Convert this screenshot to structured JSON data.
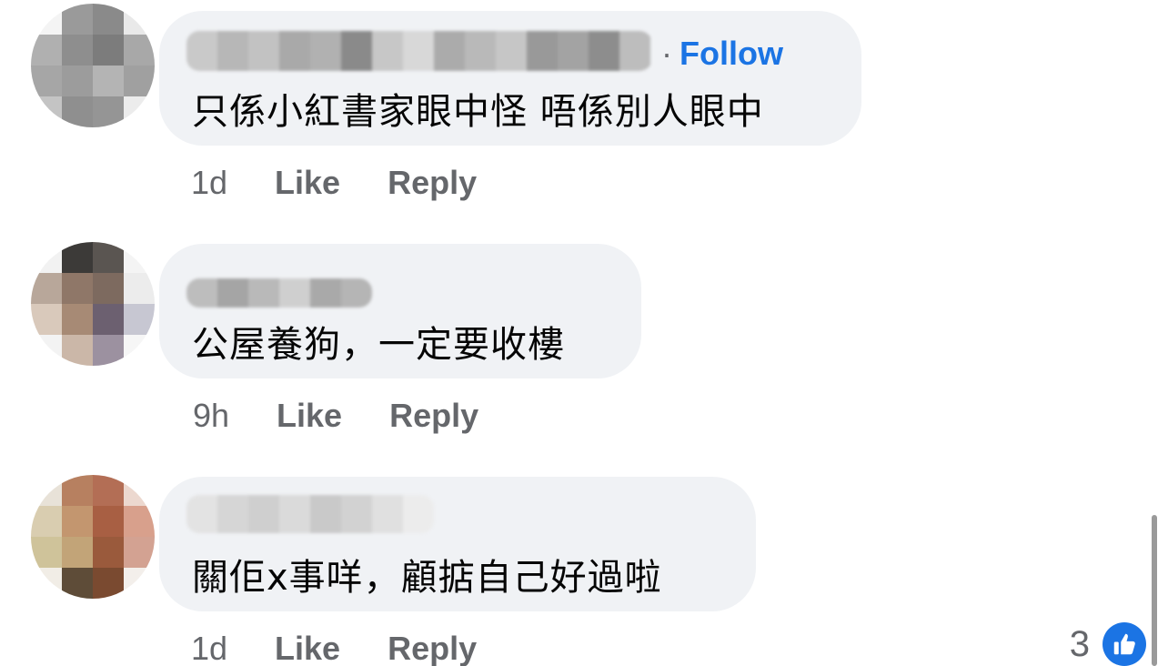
{
  "comments": [
    {
      "text": "只係小紅書家眼中怪 唔係別人眼中",
      "follow_label": "Follow",
      "follow_separator": "·",
      "time": "1d",
      "like_label": "Like",
      "reply_label": "Reply"
    },
    {
      "text": "公屋養狗，一定要收樓",
      "time": "9h",
      "like_label": "Like",
      "reply_label": "Reply"
    },
    {
      "text": "關佢x事咩，顧掂自己好過啦",
      "time": "1d",
      "like_label": "Like",
      "reply_label": "Reply",
      "reaction_count": "3",
      "reaction_icon": "like-thumb-icon"
    }
  ],
  "colors": {
    "bubble": "#f0f2f5",
    "follow": "#1b74e4",
    "meta": "#65676b",
    "text": "#050505",
    "like_badge": "#1b74e4"
  }
}
